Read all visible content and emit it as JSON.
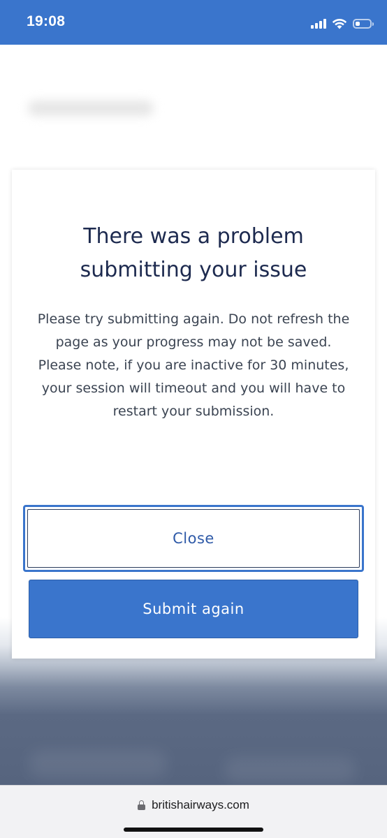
{
  "status_bar": {
    "time": "19:08",
    "icons": [
      "signal-icon",
      "wifi-icon",
      "battery-icon"
    ],
    "battery_level": 0.3,
    "background_color": "#3a75cc"
  },
  "dialog": {
    "title": "There was a problem submitting your issue",
    "message_lines": [
      "Please try submitting again. Do not refresh the page as your progress may not be saved.",
      "Please note, if you are inactive for 30 minutes, your session will timeout and you will have to restart your submission."
    ],
    "close_label": "Close",
    "submit_label": "Submit again",
    "accent_color": "#3a75cc",
    "title_color": "#1d2a4f"
  },
  "browser_bar": {
    "url": "britishairways.com",
    "icon": "lock-icon"
  }
}
